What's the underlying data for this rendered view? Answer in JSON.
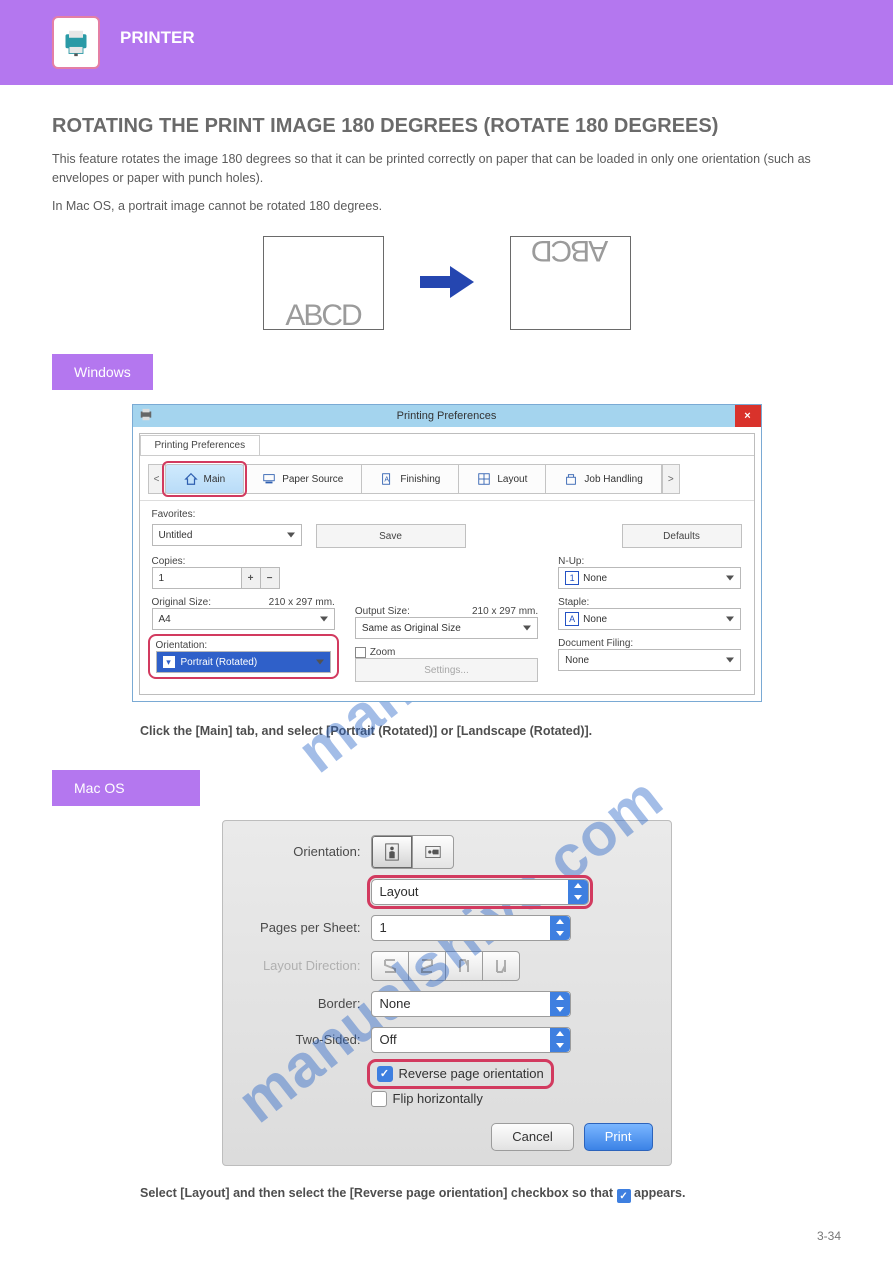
{
  "banner_title": "PRINTER",
  "section_title": "ROTATING THE PRINT IMAGE 180 DEGREES (ROTATE 180 DEGREES)",
  "intro_1": "This feature rotates the image 180 degrees so that it can be printed correctly on paper that can be loaded in only one orientation (such as envelopes or paper with punch holes).",
  "intro_2": "In Mac OS, a portrait image cannot be rotated 180 degrees.",
  "diagram_left": "ABCD",
  "diagram_right": "ABCD",
  "os_windows": "Windows",
  "os_mac": "Mac OS",
  "win": {
    "title": "Printing Preferences",
    "tab": "Printing Preferences",
    "nav_left": "<",
    "nav_right": ">",
    "tabs": [
      "Main",
      "Paper Source",
      "Finishing",
      "Layout",
      "Job Handling"
    ],
    "favorites_lbl": "Favorites:",
    "favorites_val": "Untitled",
    "save": "Save",
    "defaults": "Defaults",
    "copies_lbl": "Copies:",
    "copies_val": "1",
    "nup_lbl": "N-Up:",
    "nup_val": "None",
    "orig_lbl": "Original Size:",
    "orig_dim": "210 x 297 mm.",
    "orig_val": "A4",
    "out_lbl": "Output Size:",
    "out_dim": "210 x 297 mm.",
    "out_val": "Same as Original Size",
    "staple_lbl": "Staple:",
    "staple_val": "None",
    "orient_lbl": "Orientation:",
    "orient_val": "Portrait (Rotated)",
    "zoom_lbl": "Zoom",
    "settings": "Settings...",
    "docfile_lbl": "Document Filing:",
    "docfile_val": "None"
  },
  "win_instr_title": "Click the [Main] tab, and select [Portrait (Rotated)] or [Landscape (Rotated)].",
  "mac": {
    "orient_lbl": "Orientation:",
    "layout_val": "Layout",
    "pps_lbl": "Pages per Sheet:",
    "pps_val": "1",
    "ldir_lbl": "Layout Direction:",
    "border_lbl": "Border:",
    "border_val": "None",
    "two_lbl": "Two-Sided:",
    "two_val": "Off",
    "reverse": "Reverse page orientation",
    "flip": "Flip horizontally",
    "cancel": "Cancel",
    "print": "Print"
  },
  "mac_instr": "Select [Layout] and then select the [Reverse page orientation] checkbox so that",
  "mac_instr_tail": " appears.",
  "page_num": "3-34",
  "watermark": "manualshive.com"
}
